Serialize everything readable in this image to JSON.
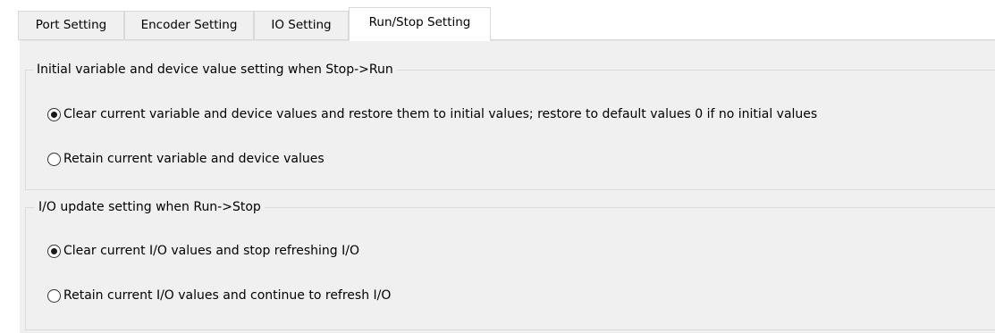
{
  "tabs": [
    {
      "label": "Port Setting",
      "active": false
    },
    {
      "label": "Encoder Setting",
      "active": false
    },
    {
      "label": "IO Setting",
      "active": false
    },
    {
      "label": "Run/Stop Setting",
      "active": true
    }
  ],
  "stop_to_run": {
    "title": "Initial variable and device value setting when Stop->Run",
    "options": [
      {
        "label": "Clear current variable and device values and restore them to initial values; restore to default values 0 if no initial values",
        "checked": true
      },
      {
        "label": "Retain current variable and device values",
        "checked": false
      }
    ]
  },
  "run_to_stop": {
    "title": "I/O update setting when Run->Stop",
    "options": [
      {
        "label": "Clear current I/O values and stop refreshing I/O",
        "checked": true
      },
      {
        "label": "Retain current I/O values and continue to refresh I/O",
        "checked": false
      }
    ]
  }
}
